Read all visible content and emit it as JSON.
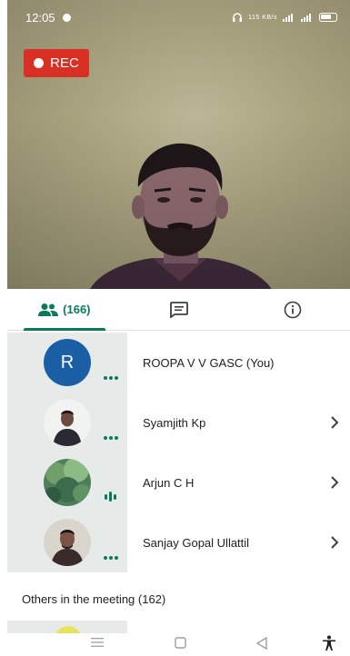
{
  "status_bar": {
    "time": "12:05",
    "right_text": "115 KB/s"
  },
  "video": {
    "rec_label": "REC"
  },
  "tabs": [
    {
      "name": "people",
      "icon": "people-icon",
      "count": "(166)",
      "active": true
    },
    {
      "name": "chat",
      "icon": "chat-icon"
    },
    {
      "name": "info",
      "icon": "info-icon"
    }
  ],
  "participants": [
    {
      "name": "ROOPA V V GASC (You)",
      "avatar_letter": "R",
      "indicator": "more",
      "chevron": false
    },
    {
      "name": "Syamjith Kp",
      "indicator": "more",
      "chevron": true
    },
    {
      "name": "Arjun C H",
      "indicator": "audio",
      "chevron": true
    },
    {
      "name": "Sanjay Gopal Ullattil",
      "indicator": "more",
      "chevron": true
    }
  ],
  "others_label": "Others in the meeting (162)",
  "colors": {
    "accent": "#0b7a5c",
    "rec": "#d93025",
    "avatar_blue": "#1a5fa6",
    "row_bg": "#e6ebea"
  }
}
